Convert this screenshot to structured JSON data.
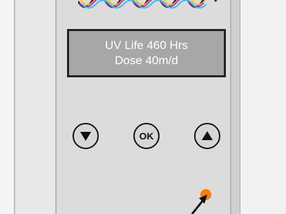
{
  "display": {
    "line1": "UV Life 460 Hrs",
    "line2": "Dose 40m/d"
  },
  "buttons": {
    "down_icon": "down-triangle-icon",
    "ok_label": "OK",
    "up_icon": "up-triangle-icon"
  },
  "indicator": {
    "color": "#f47f12"
  },
  "colors": {
    "lcd_background": "#a7a7a7",
    "panel": "#dcdcdc"
  }
}
